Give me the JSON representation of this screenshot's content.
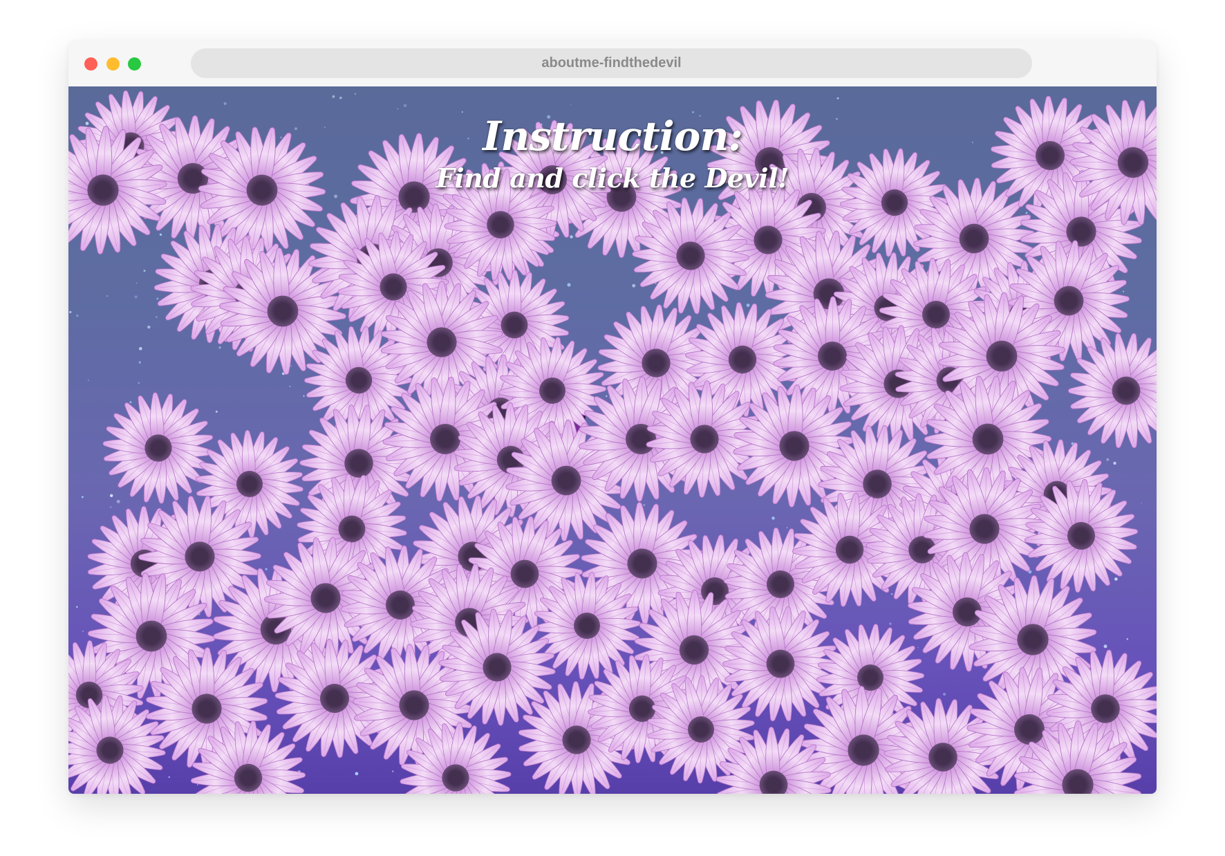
{
  "window": {
    "url_text": "aboutme-findthedevil"
  },
  "game": {
    "instruction_title": "Instruction:",
    "instruction_text": "Find and click the Devil!",
    "flower_icon": "purple-daisy",
    "hidden_target_icon": "devil-horns",
    "colors": {
      "sky_top": "#5a6a99",
      "sky_bottom": "#573faa",
      "petal": "#e2b2ea",
      "flower_center": "#43304f"
    }
  }
}
